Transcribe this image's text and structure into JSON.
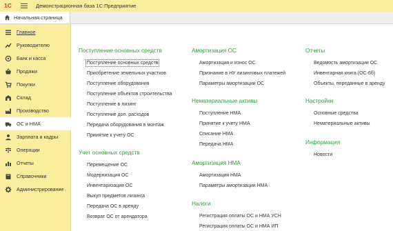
{
  "app": {
    "logo": "1С",
    "title": "Демонстрационная база 1С:Предприятие"
  },
  "tabs": {
    "home": "Начальная страница"
  },
  "sidebar": {
    "items": [
      {
        "label": "Главное",
        "icon": "list-icon"
      },
      {
        "label": "Руководителю",
        "icon": "trend-icon"
      },
      {
        "label": "Банк и касса",
        "icon": "coins-icon"
      },
      {
        "label": "Продажи",
        "icon": "basket-icon"
      },
      {
        "label": "Покупки",
        "icon": "cart-icon"
      },
      {
        "label": "Склад",
        "icon": "warehouse-icon"
      },
      {
        "label": "Производство",
        "icon": "factory-icon"
      },
      {
        "label": "ОС и НМА",
        "icon": "truck-icon"
      },
      {
        "label": "Зарплата и кадры",
        "icon": "person-icon"
      },
      {
        "label": "Операции",
        "icon": "scales-icon"
      },
      {
        "label": "Отчеты",
        "icon": "chart-icon"
      },
      {
        "label": "Справочники",
        "icon": "book-icon"
      },
      {
        "label": "Администрирование",
        "icon": "gear-icon"
      }
    ],
    "active_index": 7
  },
  "columns": [
    {
      "sections": [
        {
          "title": "Поступление основных средств",
          "links": [
            "Поступление основных средств",
            "Приобретение земельных участков",
            "Поступление оборудования",
            "Поступление объектов строительства",
            "Поступление в лизинг",
            "Поступление доп. расходов",
            "Передача оборудования в монтаж",
            "Принятие к учету ОС"
          ]
        },
        {
          "title": "Учет основных средств",
          "links": [
            "Перемещение ОС",
            "Модернизация ОС",
            "Инвентаризация ОС",
            "Выкуп предметов лизинга",
            "Передача ОС в аренду",
            "Возврат ОС от арендатора"
          ]
        }
      ]
    },
    {
      "sections": [
        {
          "title": "Амортизация ОС",
          "links": [
            "Амортизация и износ ОС",
            "Признание в НУ лизинговых платежей",
            "Параметры амортизации ОС"
          ]
        },
        {
          "title": "Нематериальные активы",
          "links": [
            "Поступление НМА",
            "Принятие к учету НМА",
            "Списание НМА",
            "Передача НМА"
          ]
        },
        {
          "title": "Амортизация НМА",
          "links": [
            "Амортизация НМА",
            "Параметры амортизации НМА"
          ]
        },
        {
          "title": "Налоги",
          "links": [
            "Регистрация оплаты ОС и НМА УСН",
            "Регистрация оплаты ОС и НМА ИП"
          ]
        }
      ]
    },
    {
      "sections": [
        {
          "title": "Отчеты",
          "links": [
            "Ведомость амортизации ОС",
            "Инвентарная книга (ОС-6б)",
            "Объекты, переданные в аренду"
          ]
        },
        {
          "title": "Настройки",
          "links": [
            "Основные средства",
            "Нематериальные активы"
          ]
        },
        {
          "title": "Информация",
          "links": [
            "Новости"
          ]
        }
      ]
    }
  ],
  "colors": {
    "sidebar_bg": "#fbed9e",
    "section_title": "#2f9e3a",
    "logo": "#d23a2a"
  }
}
